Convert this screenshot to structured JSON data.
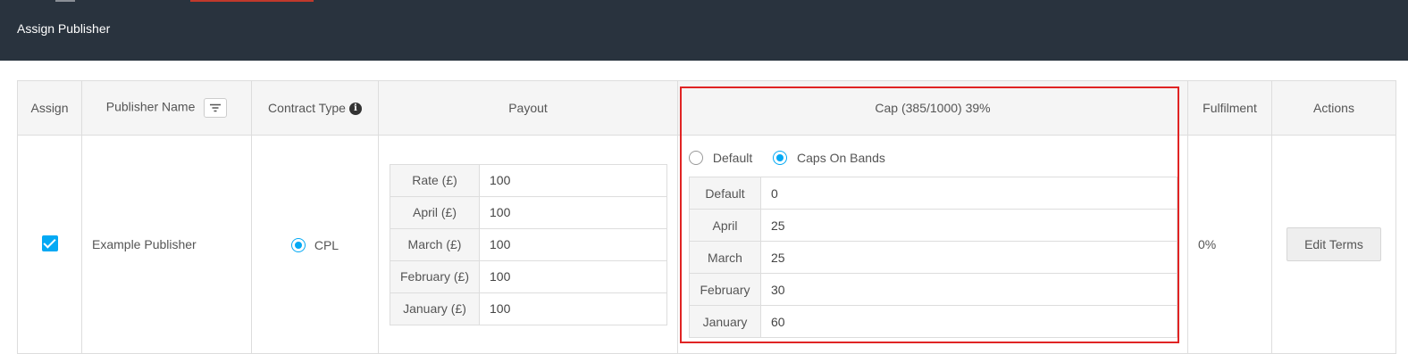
{
  "header": {
    "title": "Assign Publisher"
  },
  "table": {
    "columns": {
      "assign": "Assign",
      "publisher_name": "Publisher Name",
      "contract_type": "Contract Type",
      "payout": "Payout",
      "cap": "Cap (385/1000) 39%",
      "fulfilment": "Fulfilment",
      "actions": "Actions"
    },
    "row": {
      "assigned": true,
      "publisher_name": "Example Publisher",
      "contract_type": "CPL",
      "payout": [
        {
          "label": "Rate (£)",
          "value": "100"
        },
        {
          "label": "April (£)",
          "value": "100"
        },
        {
          "label": "March (£)",
          "value": "100"
        },
        {
          "label": "February (£)",
          "value": "100"
        },
        {
          "label": "January (£)",
          "value": "100"
        }
      ],
      "cap_mode_options": [
        "Default",
        "Caps On Bands"
      ],
      "cap_mode_selected": "Caps On Bands",
      "caps": [
        {
          "label": "Default",
          "value": "0"
        },
        {
          "label": "April",
          "value": "25"
        },
        {
          "label": "March",
          "value": "25"
        },
        {
          "label": "February",
          "value": "30"
        },
        {
          "label": "January",
          "value": "60"
        }
      ],
      "fulfilment": "0%",
      "edit_button": "Edit Terms"
    }
  },
  "colors": {
    "header_bg": "#29333e",
    "accent": "#03a9f4",
    "highlight": "#e02424"
  }
}
